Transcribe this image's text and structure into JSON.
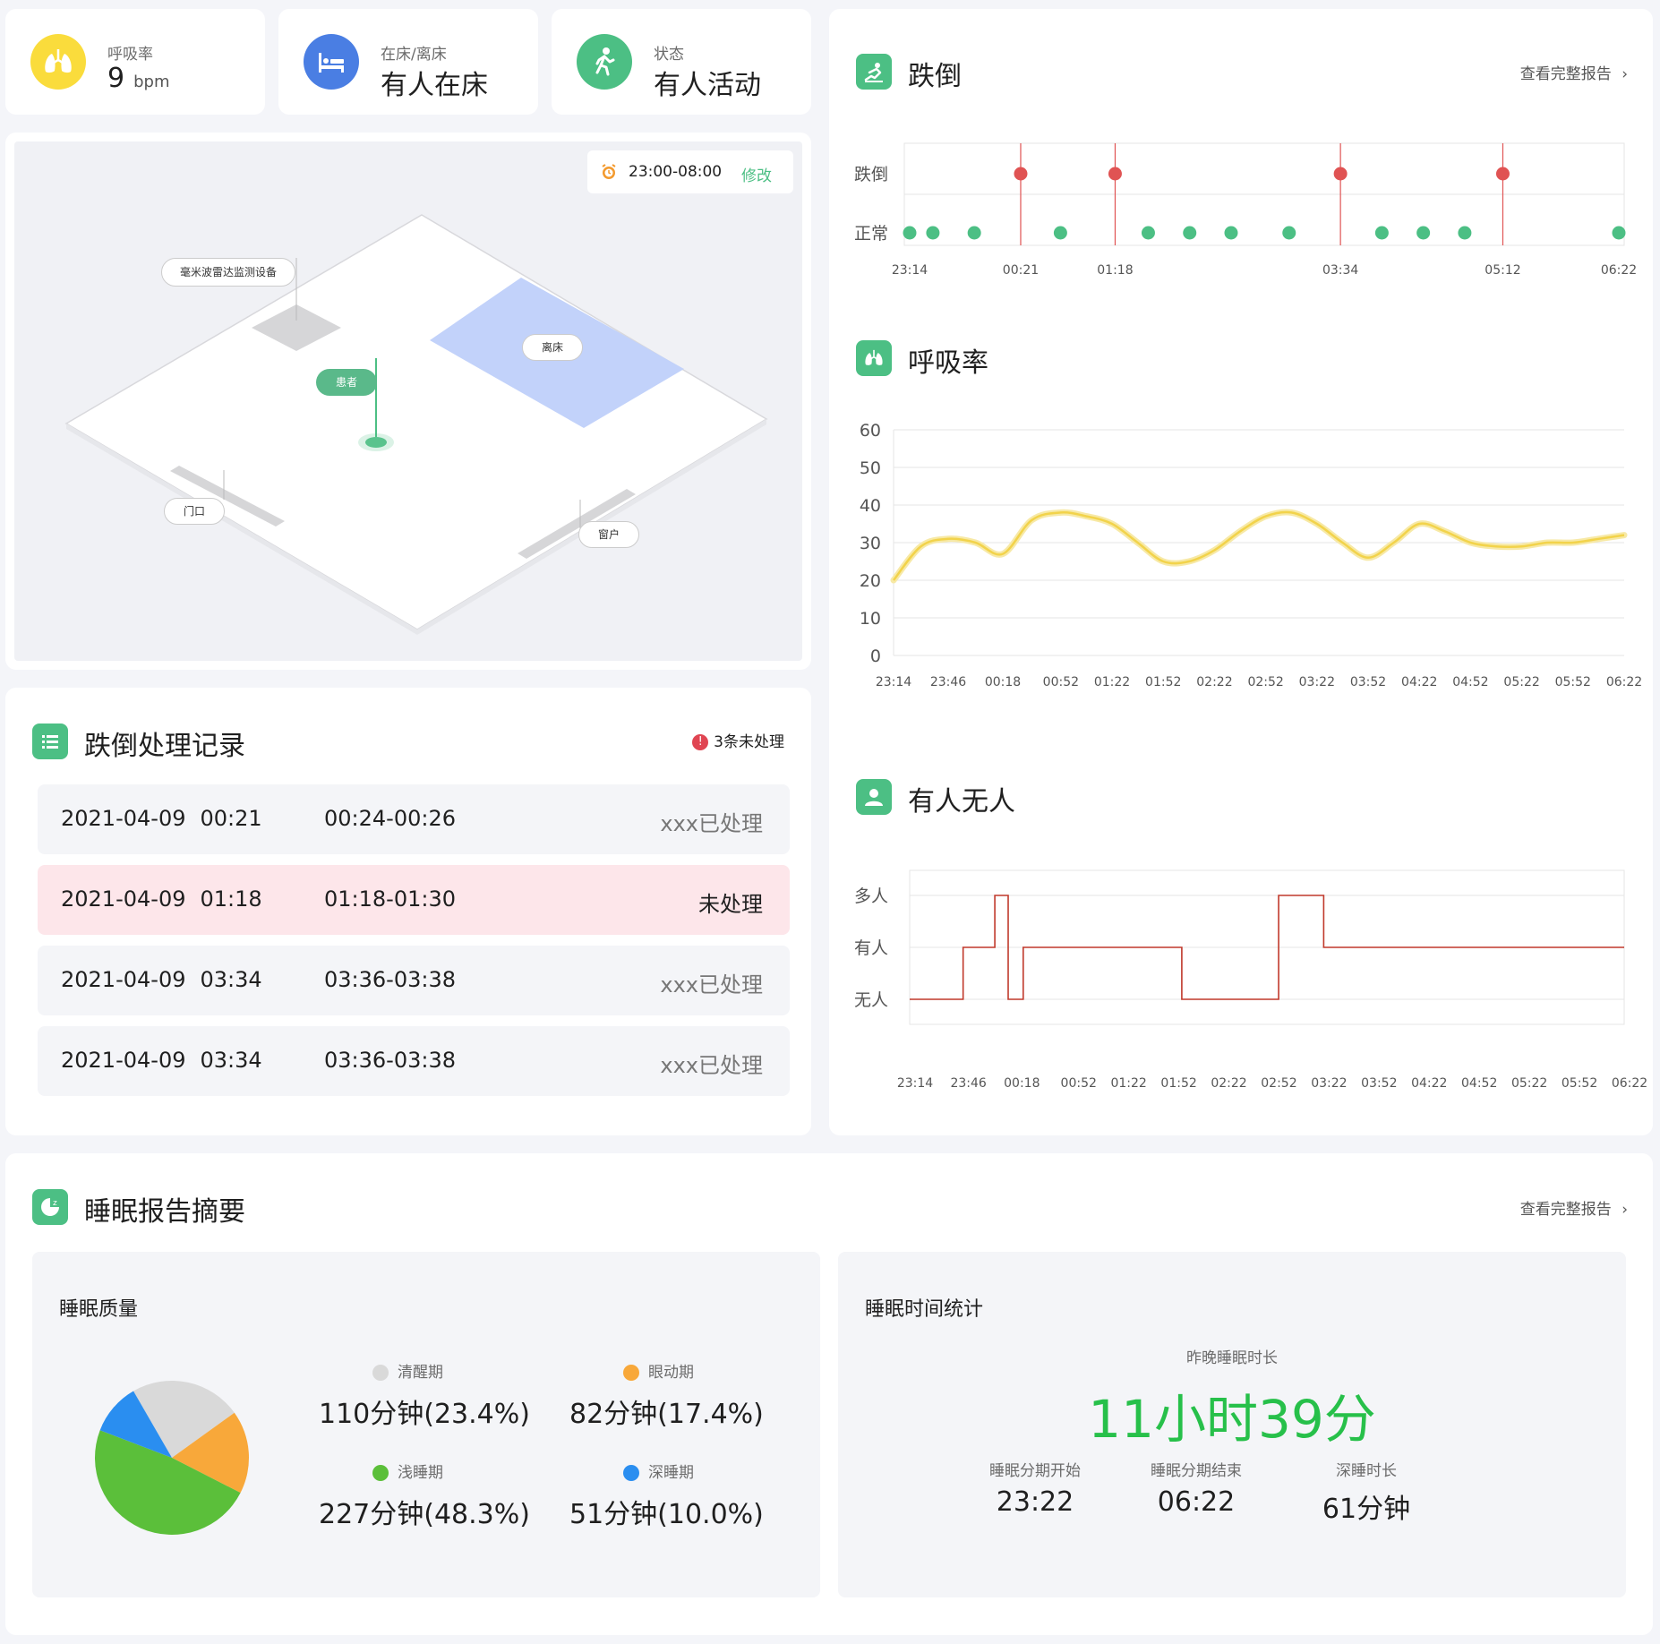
{
  "stats": [
    {
      "label": "呼吸率",
      "value": "9",
      "unit": "bpm",
      "icon": "lungs-icon",
      "color": "#fadc3c"
    },
    {
      "label": "在床/离床",
      "value": "有人在床",
      "icon": "bed-icon",
      "color": "#4a7ee3"
    },
    {
      "label": "状态",
      "value": "有人活动",
      "icon": "walking-person-icon",
      "color": "#4cbf84"
    }
  ],
  "room": {
    "schedule": "23:00-08:00",
    "edit_label": "修改",
    "device_label": "毫米波雷达监测设备",
    "bed_label": "离床",
    "patient_label": "患者",
    "door_label": "门口",
    "window_label": "窗户"
  },
  "records": {
    "title": "跌倒处理记录",
    "badge": "3条未处理",
    "rows": [
      {
        "date": "2021-04-09",
        "time": "00:21",
        "range": "00:24-00:26",
        "status": "xxx已处理",
        "alert": false
      },
      {
        "date": "2021-04-09",
        "time": "01:18",
        "range": "01:18-01:30",
        "status": "未处理",
        "alert": true
      },
      {
        "date": "2021-04-09",
        "time": "03:34",
        "range": "03:36-03:38",
        "status": "xxx已处理",
        "alert": false
      },
      {
        "date": "2021-04-09",
        "time": "03:34",
        "range": "03:36-03:38",
        "status": "xxx已处理",
        "alert": false
      }
    ]
  },
  "fall": {
    "title": "跌倒",
    "link": "查看完整报告",
    "y_labels": [
      "跌倒",
      "正常"
    ],
    "x_ticks": [
      "23:14",
      "00:21",
      "01:18",
      "03:34",
      "05:12",
      "06:22"
    ]
  },
  "breath": {
    "title": "呼吸率",
    "y_ticks": [
      "60",
      "50",
      "40",
      "30",
      "20",
      "10",
      "0"
    ],
    "x_ticks": [
      "23:14",
      "23:46",
      "00:18",
      "00:52",
      "01:22",
      "01:52",
      "02:22",
      "02:52",
      "03:22",
      "03:52",
      "04:22",
      "04:52",
      "05:22",
      "05:52",
      "06:22"
    ]
  },
  "presence": {
    "title": "有人无人",
    "y_labels": [
      "多人",
      "有人",
      "无人"
    ],
    "x_ticks": [
      "23:14",
      "23:46",
      "00:18",
      "00:52",
      "01:22",
      "01:52",
      "02:22",
      "02:52",
      "03:22",
      "03:52",
      "04:22",
      "04:52",
      "05:22",
      "05:52",
      "06:22"
    ]
  },
  "sleep": {
    "title": "睡眠报告摘要",
    "link": "查看完整报告",
    "quality_title": "睡眠质量",
    "stats_title": "睡眠时间统计",
    "duration_label": "昨晚睡眠时长",
    "duration": "11小时39分",
    "start_label": "睡眠分期开始",
    "start": "23:22",
    "end_label": "睡眠分期结束",
    "end": "06:22",
    "deep_label": "深睡时长",
    "deep": "61分钟",
    "legend": [
      {
        "label": "清醒期",
        "value": "110分钟(23.4%)",
        "color": "#d9d9d9"
      },
      {
        "label": "眼动期",
        "value": "82分钟(17.4%)",
        "color": "#f8a83a"
      },
      {
        "label": "浅睡期",
        "value": "227分钟(48.3%)",
        "color": "#5bbf3a"
      },
      {
        "label": "深睡期",
        "value": "51分钟(10.0%)",
        "color": "#2a8ef0"
      }
    ]
  },
  "chart_data": [
    {
      "type": "scatter",
      "title": "跌倒",
      "y_categories": [
        "正常",
        "跌倒"
      ],
      "x": [
        "23:14",
        "23:28",
        "23:53",
        "00:21",
        "00:45",
        "01:18",
        "01:38",
        "02:03",
        "02:28",
        "03:03",
        "03:34",
        "03:59",
        "04:24",
        "04:49",
        "05:12",
        "06:22"
      ],
      "values": [
        "正常",
        "正常",
        "正常",
        "跌倒",
        "正常",
        "跌倒",
        "正常",
        "正常",
        "正常",
        "正常",
        "跌倒",
        "正常",
        "正常",
        "正常",
        "跌倒",
        "正常"
      ],
      "colors": {
        "跌倒": "#e05353",
        "正常": "#4cbf84"
      }
    },
    {
      "type": "line",
      "title": "呼吸率",
      "x": [
        "23:14",
        "23:30",
        "23:46",
        "00:02",
        "00:18",
        "00:35",
        "00:52",
        "01:07",
        "01:22",
        "01:37",
        "01:52",
        "02:07",
        "02:22",
        "02:37",
        "02:52",
        "03:07",
        "03:22",
        "03:37",
        "03:52",
        "04:07",
        "04:22",
        "04:37",
        "04:52",
        "05:07",
        "05:22",
        "05:37",
        "05:52",
        "06:07",
        "06:22"
      ],
      "series": [
        {
          "values": [
            20,
            29,
            31,
            30,
            27,
            36,
            38,
            37,
            35,
            30,
            25,
            25,
            28,
            33,
            37,
            38,
            35,
            30,
            26,
            30,
            35,
            33,
            30,
            29,
            29,
            30,
            30,
            31,
            32
          ],
          "color": "#f2d34b"
        }
      ],
      "ylim": [
        0,
        60
      ]
    },
    {
      "type": "line",
      "title": "有人无人",
      "step": true,
      "y_categories": [
        "无人",
        "有人",
        "多人"
      ],
      "x": [
        "23:14",
        "23:46",
        "00:05",
        "00:13",
        "00:22",
        "01:57",
        "02:55",
        "03:22",
        "06:22"
      ],
      "values": [
        "无人",
        "有人",
        "多人",
        "无人",
        "有人",
        "无人",
        "多人",
        "有人",
        "有人"
      ],
      "color": "#c0392b"
    },
    {
      "type": "pie",
      "title": "睡眠质量",
      "categories": [
        "清醒期",
        "眼动期",
        "浅睡期",
        "深睡期"
      ],
      "values": [
        110,
        82,
        227,
        51
      ],
      "colors": [
        "#d9d9d9",
        "#f8a83a",
        "#5bbf3a",
        "#2a8ef0"
      ]
    }
  ]
}
